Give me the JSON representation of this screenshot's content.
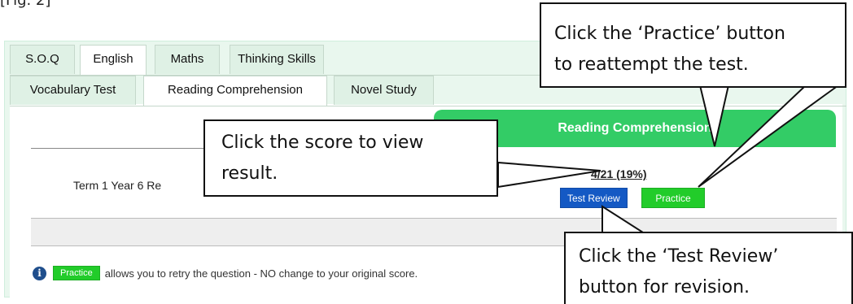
{
  "figure_label": "[Fig. 2]",
  "tabs_row1": [
    {
      "label": "S.O.Q",
      "active": false
    },
    {
      "label": "English",
      "active": true
    },
    {
      "label": "Maths",
      "active": false
    },
    {
      "label": "Thinking Skills",
      "active": false
    }
  ],
  "tabs_row2": [
    {
      "label": "Vocabulary Test",
      "active": false
    },
    {
      "label": "Reading Comprehension",
      "active": true
    },
    {
      "label": "Novel Study",
      "active": false
    }
  ],
  "section": {
    "header": "Reading Comprehension",
    "row_label": "Term 1 Year 6 Re",
    "score": "4/21 (19%)",
    "test_review_label": "Test Review",
    "practice_label": "Practice"
  },
  "info": {
    "practice_badge": "Practice",
    "text": "allows you to retry the question - NO change to your original score.",
    "icon": "info-icon"
  },
  "callouts": {
    "practice": [
      "Click the ‘Practice’ button",
      "to reattempt the test."
    ],
    "score": [
      "Click the score to view",
      "result."
    ],
    "review": [
      "Click the ‘Test Review’",
      "button for revision."
    ]
  },
  "colors": {
    "green": "#33cc66",
    "review_button": "#1459c4",
    "practice_button": "#22cc2a",
    "panel_bg": "#e9f7ee"
  }
}
